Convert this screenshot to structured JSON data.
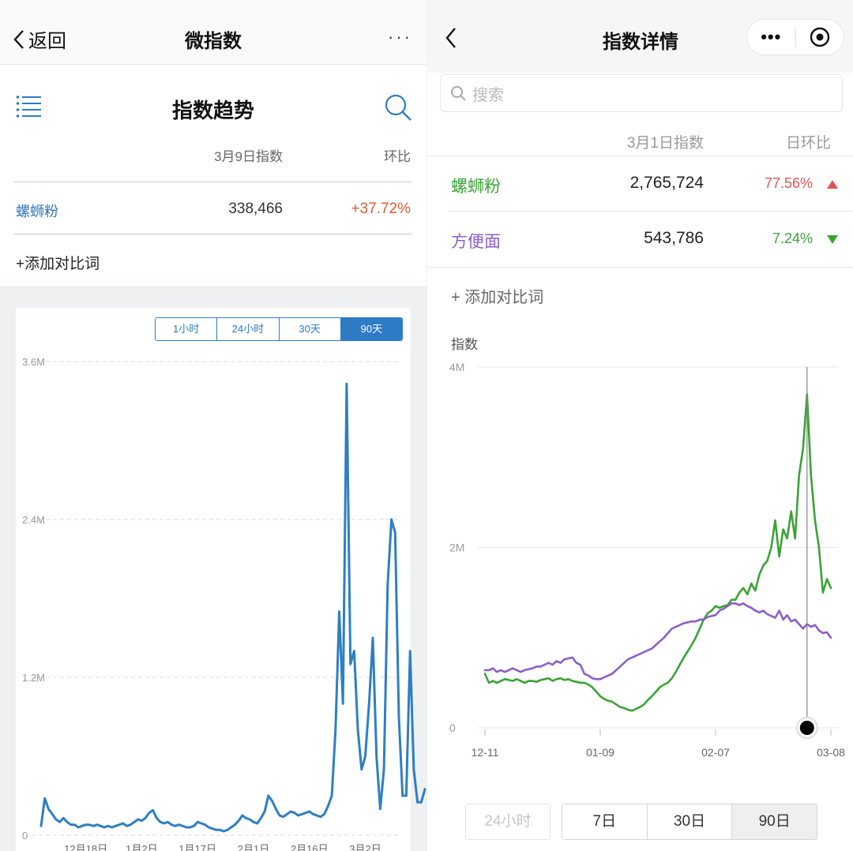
{
  "left": {
    "nav": {
      "back_label": "返回",
      "title": "微指数",
      "more_label": "···"
    },
    "section_title": "指数趋势",
    "table": {
      "col_date": "3月9日指数",
      "col_change": "环比",
      "rows": [
        {
          "name": "螺蛳粉",
          "value": "338,466",
          "change": "+37.72%"
        }
      ],
      "add_label": "+添加对比词"
    },
    "tabs": [
      {
        "label": "1小时",
        "active": false
      },
      {
        "label": "24小时",
        "active": false
      },
      {
        "label": "30天",
        "active": false
      },
      {
        "label": "90天",
        "active": true
      }
    ],
    "colors": {
      "accent": "#2e7bc6",
      "up": "#e05a33",
      "line": "#2e7fc3"
    }
  },
  "right": {
    "nav": {
      "title": "指数详情",
      "more_label": "•••"
    },
    "search": {
      "placeholder": "搜索"
    },
    "table": {
      "col_date": "3月1日指数",
      "col_change": "日环比",
      "rows": [
        {
          "name": "螺蛳粉",
          "value": "2,765,724",
          "change": "77.56%",
          "direction": "up",
          "name_color": "#3aa335",
          "change_color": "#e05555"
        },
        {
          "name": "方便面",
          "value": "543,786",
          "change": "7.24%",
          "direction": "down",
          "name_color": "#8b5fc7",
          "change_color": "#3aa335"
        }
      ],
      "add_label": "+ 添加对比词"
    },
    "chart_label": "指数",
    "buttons": {
      "h24": "24小时",
      "segments": [
        {
          "label": "7日",
          "active": false
        },
        {
          "label": "30日",
          "active": false
        },
        {
          "label": "90日",
          "active": true
        }
      ]
    }
  },
  "chart_data": [
    {
      "type": "line",
      "title": "",
      "xlabel": "",
      "ylabel": "",
      "ylim": [
        0,
        3600000
      ],
      "yticks": [
        "0",
        "1.2M",
        "2.4M",
        "3.6M"
      ],
      "ytick_values": [
        0,
        1200000,
        2400000,
        3600000
      ],
      "xticks": [
        "12月18日",
        "1月2日",
        "1月17日",
        "2月1日",
        "2月16日",
        "3月2日"
      ],
      "xtick_index": [
        12,
        27,
        42,
        57,
        72,
        87
      ],
      "x_count": 97,
      "grid": true,
      "series": [
        {
          "color": "#2e7fc3",
          "values": [
            70000,
            280000,
            200000,
            160000,
            120000,
            100000,
            130000,
            100000,
            80000,
            80000,
            60000,
            70000,
            80000,
            80000,
            70000,
            80000,
            70000,
            60000,
            70000,
            60000,
            70000,
            80000,
            90000,
            70000,
            80000,
            100000,
            120000,
            110000,
            130000,
            170000,
            190000,
            130000,
            100000,
            90000,
            100000,
            80000,
            70000,
            80000,
            70000,
            60000,
            60000,
            70000,
            100000,
            90000,
            80000,
            60000,
            50000,
            40000,
            40000,
            30000,
            40000,
            60000,
            80000,
            110000,
            150000,
            130000,
            120000,
            100000,
            90000,
            130000,
            180000,
            300000,
            260000,
            200000,
            150000,
            140000,
            160000,
            180000,
            170000,
            150000,
            160000,
            170000,
            180000,
            160000,
            150000,
            140000,
            160000,
            220000,
            300000,
            800000,
            1700000,
            1000000,
            3430000,
            1300000,
            1400000,
            800000,
            500000,
            600000,
            1000000,
            1500000,
            600000,
            200000,
            500000,
            1900000,
            2400000,
            2300000,
            900000,
            300000,
            300000,
            1400000,
            500000,
            250000,
            250000,
            350000
          ]
        }
      ]
    },
    {
      "type": "line",
      "title": "",
      "xlabel": "",
      "ylabel": "指数",
      "ylim": [
        0,
        4000000
      ],
      "yticks": [
        "0",
        "2M",
        "4M"
      ],
      "ytick_values": [
        0,
        2000000,
        4000000
      ],
      "xticks": [
        "12-11",
        "01-09",
        "02-07",
        "03-08"
      ],
      "xtick_index": [
        0,
        29,
        58,
        87
      ],
      "x_count": 88,
      "grid": true,
      "marker_index": 81,
      "series": [
        {
          "name": "螺蛳粉",
          "color": "#3aa335",
          "values": [
            600000,
            500000,
            520000,
            500000,
            520000,
            540000,
            530000,
            520000,
            540000,
            520000,
            500000,
            520000,
            520000,
            510000,
            530000,
            540000,
            550000,
            520000,
            540000,
            550000,
            530000,
            540000,
            520000,
            510000,
            500000,
            500000,
            480000,
            450000,
            400000,
            350000,
            320000,
            300000,
            290000,
            260000,
            230000,
            220000,
            200000,
            190000,
            210000,
            230000,
            260000,
            310000,
            350000,
            400000,
            450000,
            480000,
            500000,
            550000,
            620000,
            700000,
            780000,
            850000,
            920000,
            1000000,
            1100000,
            1200000,
            1270000,
            1300000,
            1350000,
            1330000,
            1350000,
            1360000,
            1420000,
            1420000,
            1500000,
            1550000,
            1480000,
            1600000,
            1520000,
            1700000,
            1800000,
            1850000,
            2000000,
            2300000,
            1900000,
            2200000,
            2100000,
            2400000,
            2100000,
            2800000,
            3100000,
            3700000,
            2800000,
            2300000,
            2000000,
            1500000,
            1650000,
            1550000
          ]
        },
        {
          "name": "方便面",
          "color": "#8b5fc7",
          "values": [
            640000,
            640000,
            660000,
            620000,
            640000,
            620000,
            640000,
            660000,
            640000,
            620000,
            640000,
            650000,
            660000,
            680000,
            680000,
            700000,
            720000,
            700000,
            740000,
            720000,
            760000,
            770000,
            780000,
            720000,
            700000,
            600000,
            580000,
            550000,
            540000,
            540000,
            560000,
            580000,
            600000,
            640000,
            680000,
            720000,
            760000,
            780000,
            800000,
            820000,
            840000,
            860000,
            880000,
            920000,
            960000,
            1000000,
            1050000,
            1100000,
            1120000,
            1140000,
            1160000,
            1170000,
            1180000,
            1180000,
            1200000,
            1200000,
            1230000,
            1240000,
            1250000,
            1300000,
            1320000,
            1350000,
            1380000,
            1380000,
            1360000,
            1380000,
            1350000,
            1330000,
            1300000,
            1280000,
            1300000,
            1260000,
            1240000,
            1220000,
            1300000,
            1200000,
            1250000,
            1180000,
            1200000,
            1150000,
            1100000,
            1150000,
            1120000,
            1140000,
            1080000,
            1050000,
            1060000,
            1000000
          ]
        }
      ]
    }
  ]
}
